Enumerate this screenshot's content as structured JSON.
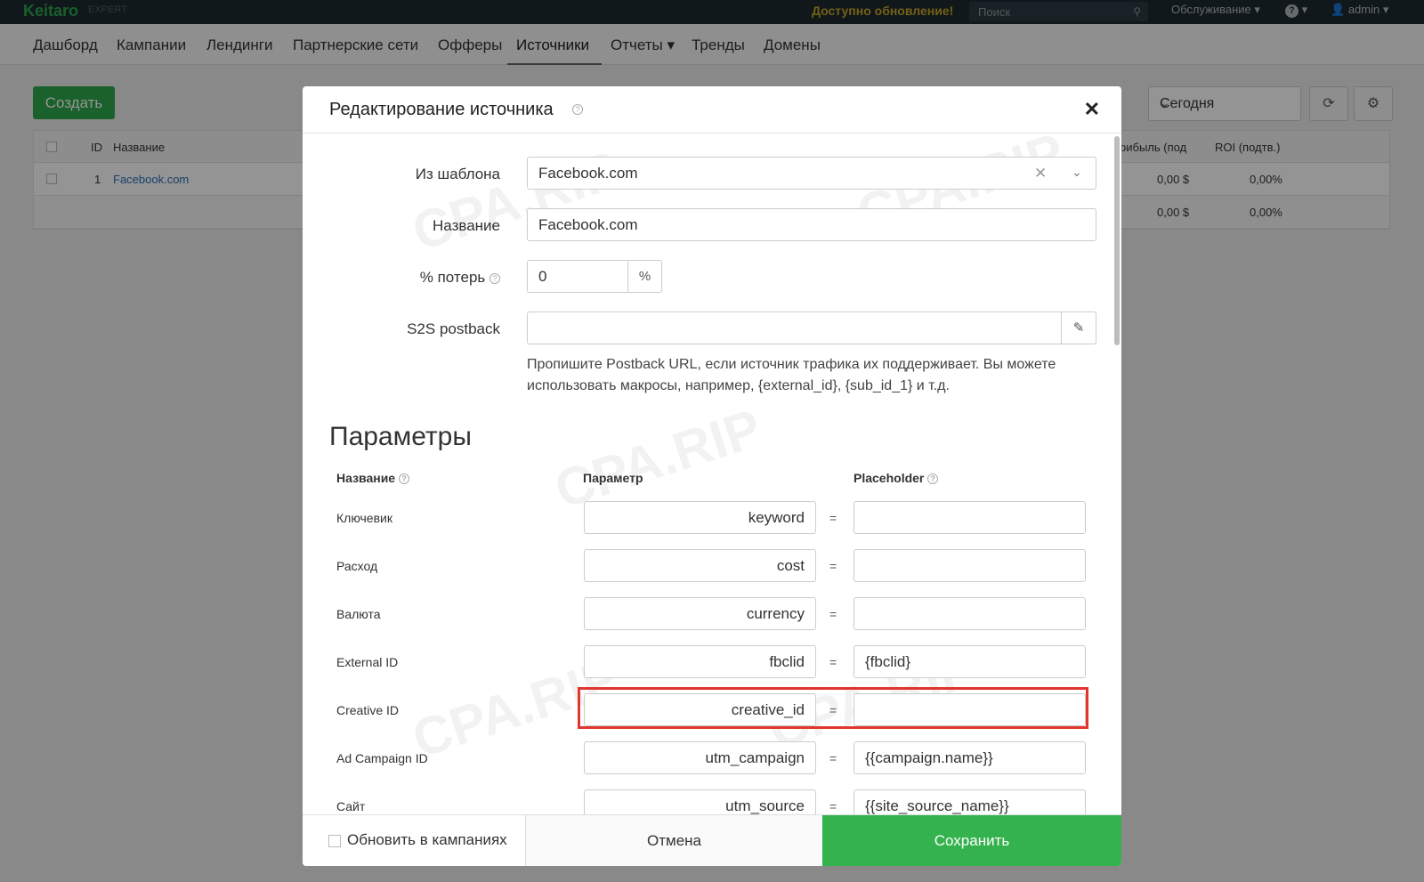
{
  "topbar": {
    "logo": "Keitaro",
    "edition": "EXPERT",
    "update_notice": "Доступно обновление!",
    "search_placeholder": "Поиск",
    "service_menu": "Обслуживание ▾",
    "help_menu": "▾",
    "user_menu": "admin ▾"
  },
  "nav": {
    "items": [
      "Дашборд",
      "Кампании",
      "Лендинги",
      "Партнерские сети",
      "Офферы",
      "Источники",
      "Отчеты ▾",
      "Тренды",
      "Домены"
    ]
  },
  "page": {
    "create_button": "Создать",
    "date_select": "Сегодня",
    "table": {
      "headers": [
        "ID",
        "Название",
        "рибыль (под",
        "ROI (подтв.)"
      ],
      "rows": [
        {
          "id": "1",
          "name": "Facebook.com",
          "profit": "0,00 $",
          "roi": "0,00%"
        }
      ],
      "totals": {
        "profit": "0,00 $",
        "roi": "0,00%"
      }
    }
  },
  "modal": {
    "title": "Редактирование источника",
    "fields": {
      "template_label": "Из шаблона",
      "template_value": "Facebook.com",
      "name_label": "Название",
      "name_value": "Facebook.com",
      "loss_label": "% потерь",
      "loss_value": "0",
      "loss_unit": "%",
      "postback_label": "S2S postback",
      "postback_value": "",
      "postback_help": "Пропишите Postback URL, если источник трафика их поддерживает. Вы можете использовать макросы, например, {external_id}, {sub_id_1} и т.д."
    },
    "params": {
      "section_title": "Параметры",
      "col_name": "Название",
      "col_param": "Параметр",
      "col_placeholder": "Placeholder",
      "equals": "=",
      "rows": [
        {
          "name": "Ключевик",
          "param": "keyword",
          "placeholder": ""
        },
        {
          "name": "Расход",
          "param": "cost",
          "placeholder": ""
        },
        {
          "name": "Валюта",
          "param": "currency",
          "placeholder": ""
        },
        {
          "name": "External ID",
          "param": "fbclid",
          "placeholder": "{fbclid}"
        },
        {
          "name": "Creative ID",
          "param": "creative_id",
          "placeholder": ""
        },
        {
          "name": "Ad Campaign ID",
          "param": "utm_campaign",
          "placeholder": "{{campaign.name}}"
        },
        {
          "name": "Сайт",
          "param": "utm_source",
          "placeholder": "{{site_source_name}}"
        }
      ]
    },
    "footer": {
      "update_in_campaigns": "Обновить в кампаниях",
      "cancel": "Отмена",
      "save": "Сохранить"
    }
  },
  "watermark": "CPA.RIP",
  "colors": {
    "accent_green": "#33b24d",
    "highlight_red": "#e0362c",
    "topbar_bg": "#1e2a30"
  }
}
